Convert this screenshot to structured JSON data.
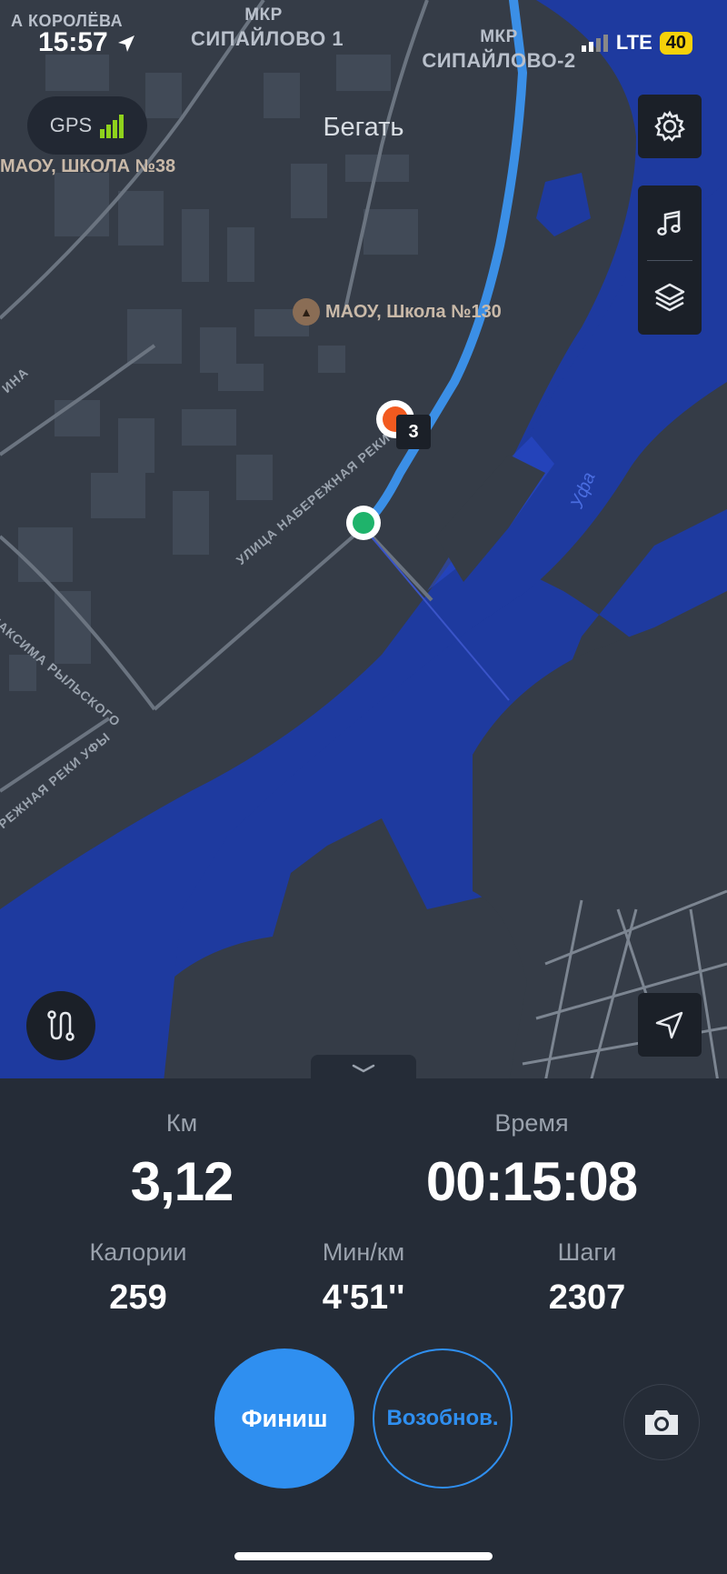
{
  "status_bar": {
    "time": "15:57",
    "network": "LTE",
    "battery": "40"
  },
  "map": {
    "gps_label": "GPS",
    "labels": {
      "top_left_street": "А КОРОЛЁВА",
      "district1_line1": "МКР",
      "district1_line2": "СИПАЙЛОВО 1",
      "district2_line1": "МКР",
      "district2_line2": "СИПАЙЛОВО-2",
      "school38": "МАОУ, ШКОЛА №38",
      "school130": "МАОУ, Школа №130",
      "street_ina": "ИНА",
      "street_maxima": "МАКСИМА РЫЛЬСКОГО",
      "street_nab1": "УЛИЦА НАБЕРЕЖНАЯ РЕКИ",
      "street_nab2": "РЕЖНАЯ РЕКИ УФЫ",
      "river": "Уфа"
    },
    "km_marker": "3"
  },
  "header": {
    "title": "Бегать"
  },
  "icons": {
    "settings": "gear-icon",
    "music": "music-note-icon",
    "layers": "layers-icon",
    "route": "route-icon",
    "locate": "navigation-arrow-icon",
    "camera": "camera-icon",
    "handle": "chevron-down-icon"
  },
  "stats": {
    "distance": {
      "label": "Км",
      "value": "3,12"
    },
    "time": {
      "label": "Время",
      "value": "00:15:08"
    },
    "calories": {
      "label": "Калории",
      "value": "259"
    },
    "pace": {
      "label": "Мин/км",
      "value": "4'51''"
    },
    "steps": {
      "label": "Шаги",
      "value": "2307"
    }
  },
  "buttons": {
    "finish": "Финиш",
    "resume": "Возобнов."
  },
  "colors": {
    "accent": "#2f8ff0",
    "river": "#1e3a9f",
    "route": "#3b8fe6",
    "start": "#1fb36b",
    "current": "#f25a1f",
    "gps_bars": "#8fd21c"
  }
}
